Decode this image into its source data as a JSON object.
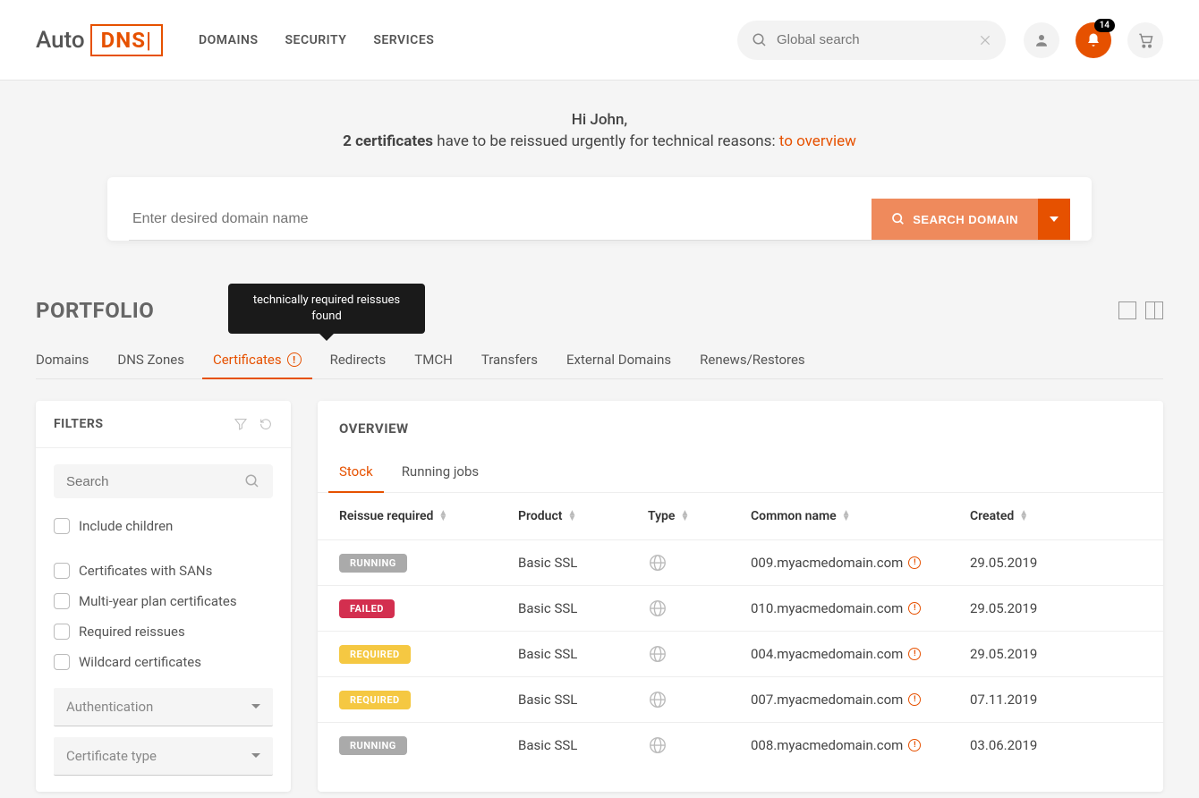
{
  "header": {
    "logo_text": "Auto",
    "logo_box": "DNS|",
    "nav": [
      "DOMAINS",
      "SECURITY",
      "SERVICES"
    ],
    "search_placeholder": "Global search",
    "notification_count": "14"
  },
  "banner": {
    "greeting": "Hi John,",
    "count": "2 certificates",
    "message": " have to be reissued urgently for technical reasons: ",
    "link": "to overview"
  },
  "domain_search": {
    "placeholder": "Enter desired domain name",
    "button": "SEARCH DOMAIN"
  },
  "portfolio": {
    "title": "PORTFOLIO",
    "tooltip": "technically required reissues found",
    "tabs": [
      "Domains",
      "DNS Zones",
      "Certificates",
      "Redirects",
      "TMCH",
      "Transfers",
      "External Domains",
      "Renews/Restores"
    ]
  },
  "filters": {
    "title": "FILTERS",
    "search_placeholder": "Search",
    "checkboxes": [
      "Include children",
      "Certificates with SANs",
      "Multi-year plan certificates",
      "Required reissues",
      "Wildcard certificates"
    ],
    "selects": [
      "Authentication",
      "Certificate type"
    ]
  },
  "overview": {
    "title": "OVERVIEW",
    "sub_tabs": [
      "Stock",
      "Running jobs"
    ],
    "columns": [
      "Reissue required",
      "Product",
      "Type",
      "Common name",
      "Created"
    ],
    "rows": [
      {
        "status": "RUNNING",
        "status_class": "status-running",
        "product": "Basic SSL",
        "common": "009.myacmedomain.com",
        "alert": true,
        "created": "29.05.2019"
      },
      {
        "status": "FAILED",
        "status_class": "status-failed",
        "product": "Basic SSL",
        "common": "010.myacmedomain.com",
        "alert": true,
        "created": "29.05.2019"
      },
      {
        "status": "REQUIRED",
        "status_class": "status-required",
        "product": "Basic SSL",
        "common": "004.myacmedomain.com",
        "alert": true,
        "created": "29.05.2019"
      },
      {
        "status": "REQUIRED",
        "status_class": "status-required",
        "product": "Basic SSL",
        "common": "007.myacmedomain.com",
        "alert": true,
        "created": "07.11.2019"
      },
      {
        "status": "RUNNING",
        "status_class": "status-running",
        "product": "Basic SSL",
        "common": "008.myacmedomain.com",
        "alert": true,
        "created": "03.06.2019"
      }
    ]
  }
}
